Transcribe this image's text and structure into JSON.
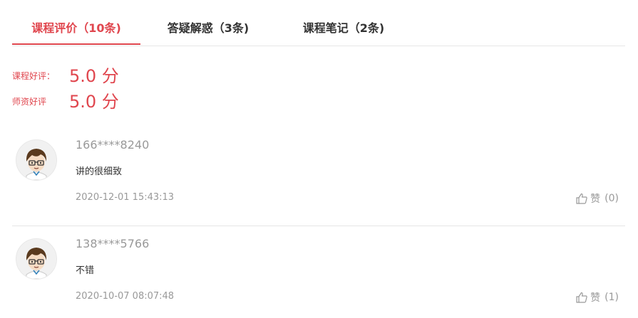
{
  "tabs": [
    {
      "label": "课程评价（10条)"
    },
    {
      "label": "答疑解惑（3条)"
    },
    {
      "label": "课程笔记（2条)"
    }
  ],
  "active_tab_index": 0,
  "ratings": {
    "course": {
      "label": "课程好评：",
      "score": "5.0 分"
    },
    "teacher": {
      "label": "师资好评",
      "score": "5.0 分"
    }
  },
  "reviews": [
    {
      "user": "166****8240",
      "content": "讲的很细致",
      "time": "2020-12-01 15:43:13",
      "like_label": "赞",
      "like_count": "(0)"
    },
    {
      "user": "138****5766",
      "content": "不错",
      "time": "2020-10-07 08:07:48",
      "like_label": "赞",
      "like_count": "(1)"
    }
  ],
  "icons": {
    "avatar": "cartoon-avatar-icon",
    "like": "thumbs-up-icon"
  },
  "colors": {
    "accent": "#e0464e",
    "muted": "#999999",
    "text": "#333333",
    "divider": "#e6e6e6"
  }
}
